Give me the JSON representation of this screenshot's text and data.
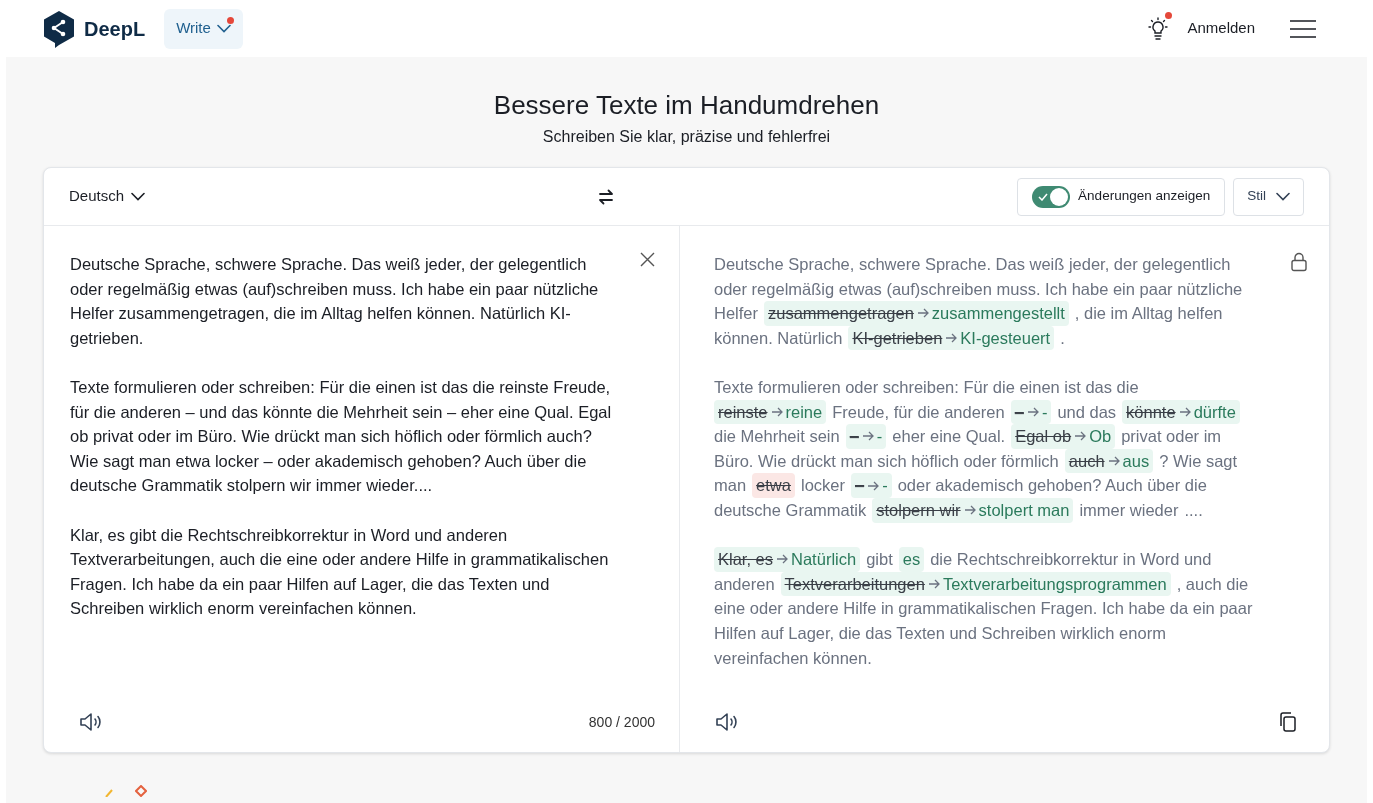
{
  "header": {
    "brand": "DeepL",
    "mode_button": {
      "label": "Write",
      "notification": true
    },
    "tips_notification": true,
    "login": "Anmelden"
  },
  "hero": {
    "title": "Bessere Texte im Handumdrehen",
    "subtitle": "Schreiben Sie klar, präzise und fehlerfrei"
  },
  "toolbar": {
    "language": "Deutsch",
    "show_changes": {
      "label": "Änderungen anzeigen",
      "on": true
    },
    "style": "Stil"
  },
  "source": {
    "paragraphs": [
      "Deutsche Sprache, schwere Sprache. Das weiß jeder, der gelegentlich oder regelmäßig etwas (auf)schreiben muss. Ich habe ein paar nützliche Helfer zusammengetragen, die im Alltag helfen können. Natürlich KI-getrieben.",
      "Texte formulieren oder schreiben: Für die einen ist das die reinste Freude, für die anderen – und das könnte die Mehrheit sein – eher eine Qual. Egal ob privat oder im Büro. Wie drückt man sich höflich oder förmlich auch? Wie sagt man etwa locker – oder akademisch gehoben? Auch über die deutsche Grammatik stolpern wir immer wieder....",
      "Klar, es gibt die Rechtschreibkorrektur in Word und anderen Textverarbeitungen, auch die eine oder andere Hilfe in grammatikalischen Fragen. Ich habe da ein paar Hilfen auf Lager, die das Texten und Schreiben wirklich enorm vereinfachen können."
    ],
    "counter": "800 / 2000"
  },
  "result": {
    "paragraphs": [
      {
        "lines": [
          [
            {
              "kind": "text",
              "text": "Deutsche Sprache, schwere Sprache. Das weiß jeder, der gelegentlich"
            }
          ],
          [
            {
              "kind": "text",
              "text": "oder regelmäßig etwas (auf)schreiben muss. Ich habe ein paar nützliche"
            }
          ],
          [
            {
              "kind": "text",
              "text": "Helfer"
            },
            {
              "kind": "change",
              "old": "zusammengetragen",
              "new": "zusammengestellt"
            },
            {
              "kind": "text",
              "text": ", die im Alltag helfen"
            }
          ],
          [
            {
              "kind": "text",
              "text": "können. Natürlich"
            },
            {
              "kind": "change",
              "old": "KI-getrieben",
              "new": "KI-gesteuert"
            },
            {
              "kind": "text",
              "text": "."
            }
          ]
        ]
      },
      {
        "lines": [
          [
            {
              "kind": "text",
              "text": "Texte formulieren oder schreiben: Für die einen ist das die"
            }
          ],
          [
            {
              "kind": "change",
              "old": "reinste",
              "new": "reine"
            },
            {
              "kind": "text",
              "text": "Freude, für die anderen"
            },
            {
              "kind": "change",
              "old": "–",
              "new": "-"
            },
            {
              "kind": "text",
              "text": "und das"
            },
            {
              "kind": "change",
              "old": "könnte",
              "new": "dürfte"
            }
          ],
          [
            {
              "kind": "text",
              "text": "die Mehrheit sein"
            },
            {
              "kind": "change",
              "old": "–",
              "new": "-"
            },
            {
              "kind": "text",
              "text": "eher eine Qual."
            },
            {
              "kind": "change",
              "old": "Egal ob",
              "new": "Ob"
            },
            {
              "kind": "text",
              "text": "privat oder im"
            }
          ],
          [
            {
              "kind": "text",
              "text": "Büro. Wie drückt man sich höflich oder förmlich"
            },
            {
              "kind": "change",
              "old": "auch",
              "new": "aus"
            },
            {
              "kind": "text",
              "text": "? Wie sagt"
            }
          ],
          [
            {
              "kind": "text",
              "text": "man"
            },
            {
              "kind": "delete",
              "old": "etwa"
            },
            {
              "kind": "text",
              "text": "locker"
            },
            {
              "kind": "change",
              "old": "–",
              "new": "-"
            },
            {
              "kind": "text",
              "text": "oder akademisch gehoben? Auch über die"
            }
          ],
          [
            {
              "kind": "text",
              "text": "deutsche Grammatik"
            },
            {
              "kind": "change",
              "old": "stolpern wir",
              "new": "stolpert man"
            },
            {
              "kind": "text",
              "text": "immer wieder"
            },
            {
              "kind": "text",
              "text": "...."
            }
          ]
        ]
      },
      {
        "lines": [
          [
            {
              "kind": "change",
              "old": "Klar, es",
              "new": "Natürlich"
            },
            {
              "kind": "text",
              "text": "gibt"
            },
            {
              "kind": "insert",
              "new": "es"
            },
            {
              "kind": "text",
              "text": "die Rechtschreibkorrektur in Word und"
            }
          ],
          [
            {
              "kind": "text",
              "text": "anderen"
            },
            {
              "kind": "change",
              "old": "Textverarbeitungen",
              "new": "Textverarbeitungsprogrammen"
            },
            {
              "kind": "text",
              "text": ", auch die"
            }
          ],
          [
            {
              "kind": "text",
              "text": "eine oder andere Hilfe in grammatikalischen Fragen. Ich habe da ein paar"
            }
          ],
          [
            {
              "kind": "text",
              "text": "Hilfen auf Lager, die das Texten und Schreiben wirklich enorm"
            }
          ],
          [
            {
              "kind": "text",
              "text": "vereinfachen können."
            }
          ]
        ]
      }
    ]
  }
}
